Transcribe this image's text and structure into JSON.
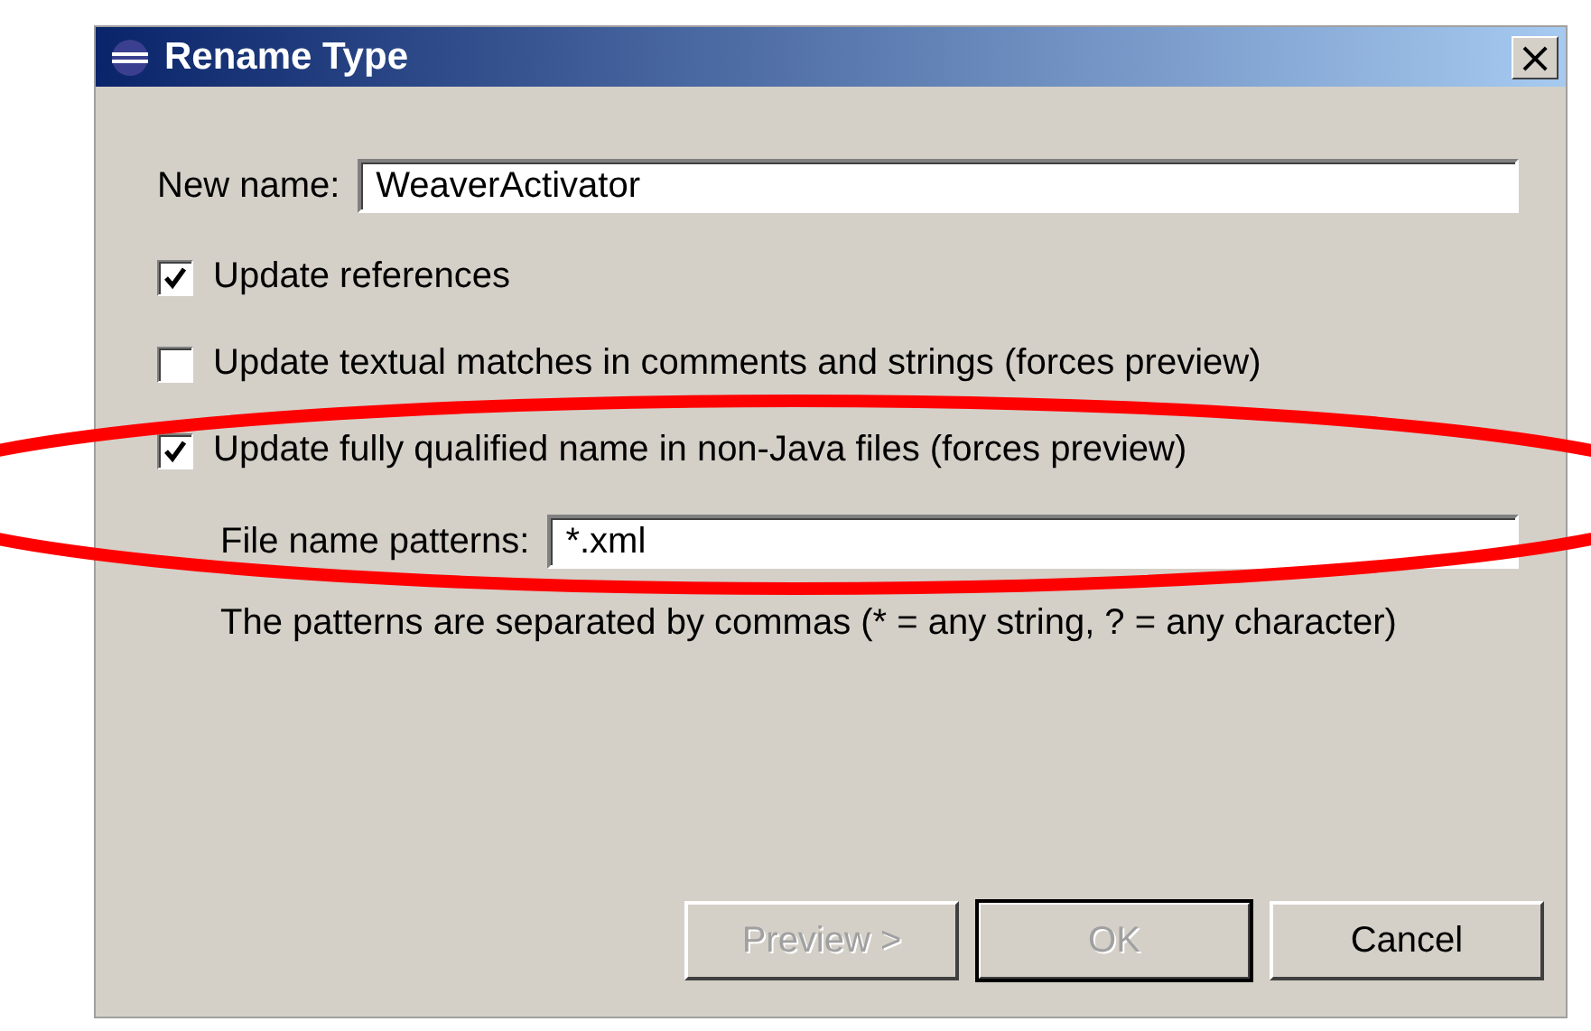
{
  "window": {
    "title": "Rename Type",
    "close": "×"
  },
  "new_name": {
    "label": "New name:",
    "value": "WeaverActivator"
  },
  "options": [
    {
      "label": "Update references",
      "checked": true
    },
    {
      "label": "Update textual matches in comments and strings (forces preview)",
      "checked": false
    },
    {
      "label": "Update fully qualified name in non-Java files (forces preview)",
      "checked": true
    }
  ],
  "patterns": {
    "label": "File name patterns:",
    "value": "*.xml",
    "hint": "The patterns are separated by commas (* = any string, ? = any character)"
  },
  "buttons": [
    {
      "label": "Preview >",
      "disabled": true,
      "default": false
    },
    {
      "label": "OK",
      "disabled": true,
      "default": true
    },
    {
      "label": "Cancel",
      "disabled": false,
      "default": false
    }
  ],
  "annotation": {
    "kind": "ellipse",
    "color": "#ff0000"
  }
}
